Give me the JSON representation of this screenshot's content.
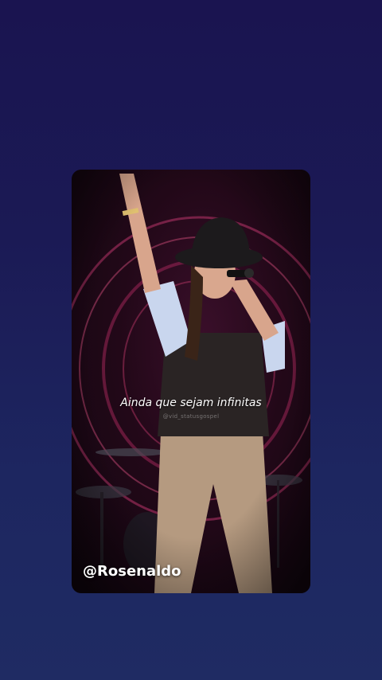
{
  "video": {
    "caption": "Ainda que sejam infinitas",
    "watermark": "@vid_statusgospel",
    "handle": "@Rosenaldo"
  },
  "colors": {
    "background_top": "#1a1450",
    "background_bottom": "#1f2b63",
    "stage_ring": "#c23a6a",
    "caption_text": "#ffffff"
  }
}
